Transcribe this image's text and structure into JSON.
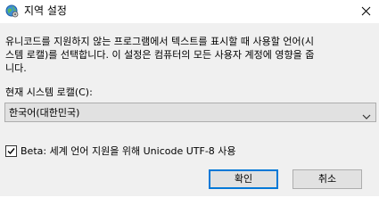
{
  "dialog": {
    "title": "지역 설정",
    "icon": "globe-settings-icon",
    "close_icon": "close-icon"
  },
  "main": {
    "description_lines": [
      "유니코드를 지원하지 않는 프로그램에서 텍스트를 표시할 때 사용할 언어(시",
      "스템 로캘)를 선택합니다. 이 설정은 컴퓨터의 모든 사용자 계정에 영향을 줍",
      "니다."
    ],
    "locale_label": "현재 시스템 로캘(C):",
    "locale_selected": "한국어(대한민국)",
    "beta_checkbox": {
      "checked": true,
      "label": "Beta: 세계 언어 지원을 위해 Unicode UTF-8 사용"
    }
  },
  "buttons": {
    "ok": "확인",
    "cancel": "취소"
  },
  "colors": {
    "accent": "#0078d7",
    "panel_bg": "#f0f0f0",
    "button_bg": "#e1e1e1"
  }
}
